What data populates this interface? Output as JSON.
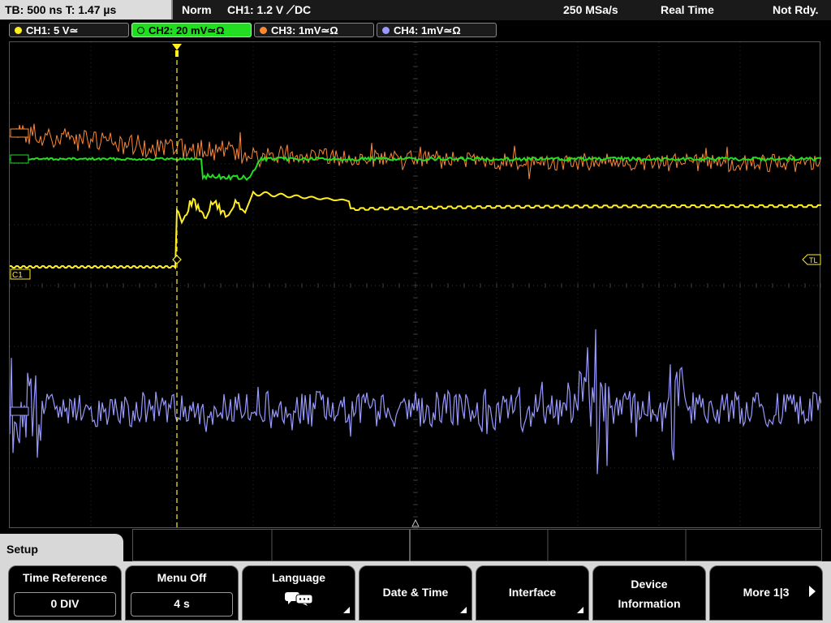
{
  "status_bar": {
    "timebase": "TB: 500 ns   T: 1.47 µs",
    "mode": "Norm",
    "trigger": "CH1: 1.2 V ⟋DC",
    "sample_rate": "250 MSa/s",
    "acq_mode": "Real Time",
    "status": "Not Rdy."
  },
  "channels": [
    {
      "label": "CH1: 5 V≃",
      "color": "#ffee22",
      "active": false
    },
    {
      "label": "CH2: 20 mV≃Ω",
      "color": "#22dd22",
      "active": true
    },
    {
      "label": "CH3: 1mV≃Ω",
      "color": "#ff8833",
      "active": false
    },
    {
      "label": "CH4: 1mV≃Ω",
      "color": "#9999ff",
      "active": false
    }
  ],
  "markers": {
    "ch1": "C1",
    "trigger_level": "TL"
  },
  "menu": {
    "title": "Setup",
    "softkeys": {
      "time_reference": {
        "label": "Time Reference",
        "value": "0 DIV"
      },
      "menu_off": {
        "label": "Menu Off",
        "value": "4 s"
      },
      "language": {
        "label": "Language"
      },
      "date_time": {
        "label": "Date & Time"
      },
      "interface": {
        "label": "Interface"
      },
      "device_info": {
        "line1": "Device",
        "line2": "Information"
      },
      "more": {
        "label": "More 1|3"
      }
    }
  },
  "colors": {
    "ch1": "#ffee22",
    "ch2": "#22dd22",
    "ch3": "#ff8833",
    "ch4": "#9999ff",
    "grid": "#555555"
  }
}
